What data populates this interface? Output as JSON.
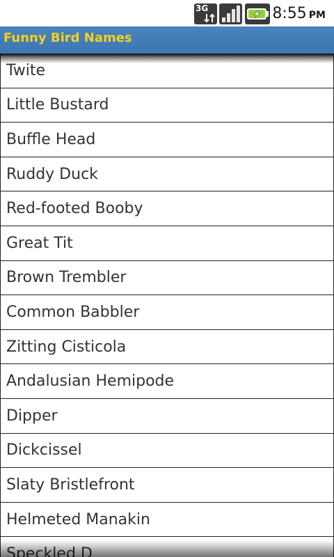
{
  "status_bar": {
    "network_type": "3G",
    "time": "8:55",
    "ampm": "PM",
    "icons": [
      "network-3g-icon",
      "signal-strength-icon",
      "battery-charging-icon"
    ]
  },
  "title_bar": {
    "title": "Funny Bird Names",
    "background_color": "#3d7ab8",
    "title_color": "#f3d21e"
  },
  "list": {
    "items": [
      {
        "label": "Twite"
      },
      {
        "label": "Little Bustard"
      },
      {
        "label": "Buffle Head"
      },
      {
        "label": "Ruddy Duck"
      },
      {
        "label": "Red-footed Booby"
      },
      {
        "label": "Great Tit"
      },
      {
        "label": "Brown Trembler"
      },
      {
        "label": "Common Babbler"
      },
      {
        "label": "Zitting Cisticola"
      },
      {
        "label": "Andalusian Hemipode"
      },
      {
        "label": "Dipper"
      },
      {
        "label": "Dickcissel"
      },
      {
        "label": "Slaty Bristlefront"
      },
      {
        "label": "Helmeted Manakin"
      },
      {
        "label": "Speckled D"
      }
    ]
  }
}
